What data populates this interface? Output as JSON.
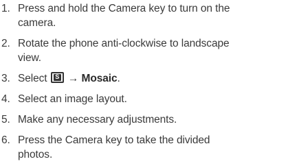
{
  "steps": [
    {
      "num": "1.",
      "lines": [
        "Press and hold the Camera key to turn on the",
        "camera."
      ]
    },
    {
      "num": "2.",
      "lines": [
        "Rotate the phone anti-clockwise to landscape",
        "view."
      ]
    },
    {
      "num": "3.",
      "prefix": "Select",
      "icon_glyph": "S",
      "arrow": "→",
      "bold": "Mosaic",
      "suffix": "."
    },
    {
      "num": "4.",
      "lines": [
        "Select an image layout."
      ]
    },
    {
      "num": "5.",
      "lines": [
        "Make any necessary adjustments."
      ]
    },
    {
      "num": "6.",
      "lines": [
        "Press the Camera key to take the divided",
        "photos."
      ]
    }
  ]
}
